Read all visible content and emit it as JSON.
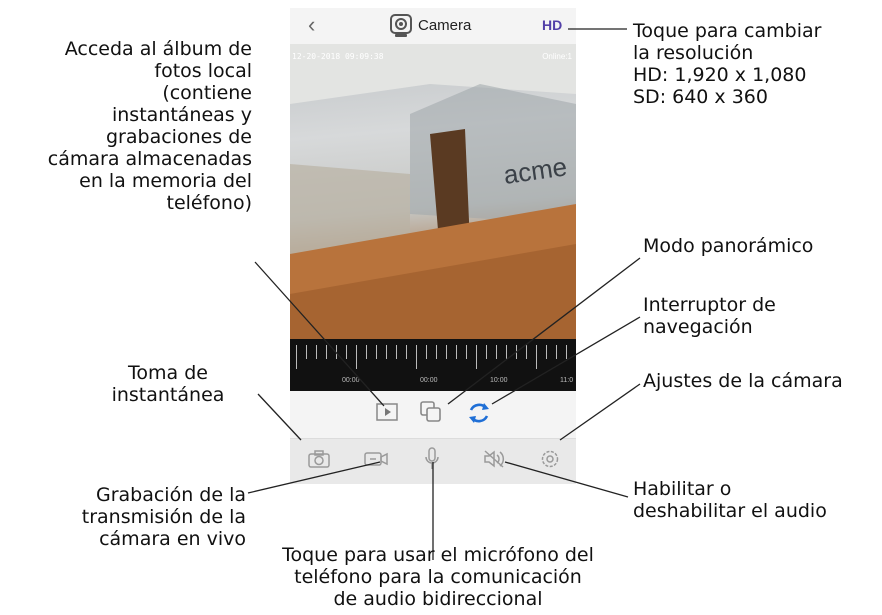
{
  "app": {
    "title": "Camera",
    "resolution_button": "HD",
    "timestamp": "12-20-2018 09:09:38",
    "status": "Online:1",
    "timeline_labels": [
      "00:00",
      "00:00",
      "10:00",
      "11:0"
    ]
  },
  "annotations": {
    "resolution": [
      "Toque para cambiar",
      "la resolución",
      "HD: 1,920 x 1,080",
      "SD: 640 x 360"
    ],
    "album": [
      "Acceda al álbum de",
      "fotos local",
      "(contiene",
      "instantáneas y",
      "grabaciones de",
      "cámara almacenadas",
      "en la memoria del",
      "teléfono)"
    ],
    "panoramic": [
      "Modo panorámico"
    ],
    "navigation": [
      "Interruptor de",
      "navegación"
    ],
    "snapshot": [
      "Toma de",
      "instantánea"
    ],
    "camera_settings": [
      "Ajustes de la cámara"
    ],
    "recording": [
      "Grabación de la",
      "transmisión de la",
      "cámara en vivo"
    ],
    "audio": [
      "Habilitar o",
      "deshabilitar el audio"
    ],
    "microphone": [
      "Toque para usar el micrófono del",
      "teléfono para la comunicación",
      "de audio bidireccional"
    ]
  },
  "colors": {
    "accent_blue": "#1f6fd6",
    "hd_purple": "#5340a8",
    "icon_gray": "#9a9a9a"
  },
  "icons": {
    "back": "chevron-left-icon",
    "camera": "camera-app-icon",
    "album": "play-album-icon",
    "panoramic": "overlap-squares-icon",
    "navigation": "refresh-icon",
    "snapshot": "camera-icon",
    "record": "video-camera-icon",
    "mic": "microphone-icon",
    "audio": "speaker-mute-icon",
    "settings": "gear-icon"
  }
}
